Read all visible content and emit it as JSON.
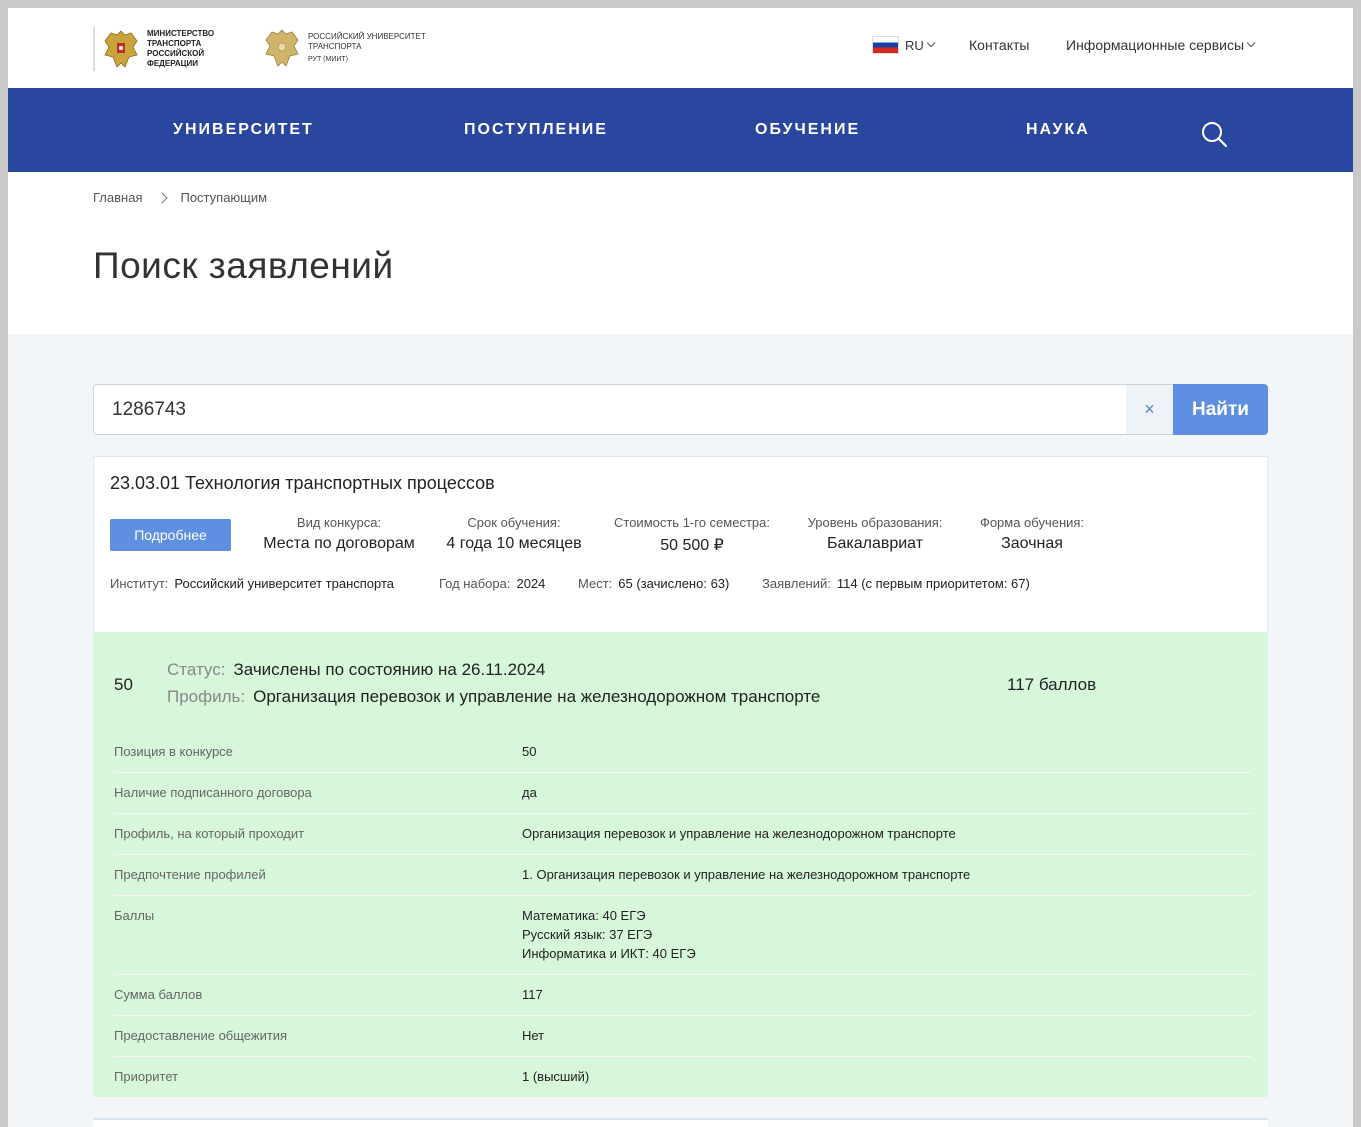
{
  "header": {
    "mintrans_logo_text": "МИНИСТЕРСТВО ТРАНСПОРТА РОССИЙСКОЙ ФЕДЕРАЦИИ",
    "rut_logo_text": "РОССИЙСКИЙ УНИВЕРСИТЕТ ТРАНСПОРТА",
    "rut_logo_abbr": "РУТ (МИИТ)",
    "lang": "RU",
    "contacts": "Контакты",
    "info_services": "Информационные сервисы"
  },
  "nav": {
    "items": [
      "УНИВЕРСИТЕТ",
      "ПОСТУПЛЕНИЕ",
      "ОБУЧЕНИЕ",
      "НАУКА"
    ]
  },
  "breadcrumb": [
    "Главная",
    "Поступающим"
  ],
  "page_title": "Поиск заявлений",
  "search": {
    "value": "1286743",
    "clear": "×",
    "button": "Найти"
  },
  "program": {
    "title": "23.03.01 Технология транспортных процессов",
    "more_button": "Подробнее",
    "meta": [
      {
        "label": "Вид конкурса:",
        "value": "Места по договорам"
      },
      {
        "label": "Срок обучения:",
        "value": "4 года 10 месяцев"
      },
      {
        "label": "Стоимость 1-го семестра:",
        "value": "50 500 ₽"
      },
      {
        "label": "Уровень образования:",
        "value": "Бакалавриат"
      },
      {
        "label": "Форма обучения:",
        "value": "Заочная"
      }
    ],
    "info": [
      {
        "label": "Институт:",
        "value": "Российский университет транспорта"
      },
      {
        "label": "Год набора:",
        "value": "2024"
      },
      {
        "label": "Мест:",
        "value": "65 (зачислено: 63)"
      },
      {
        "label": "Заявлений:",
        "value": "114 (с первым приоритетом: 67)"
      }
    ]
  },
  "result": {
    "number": "50",
    "status_label": "Статус:",
    "status_value": "Зачислены по состоянию на 26.11.2024",
    "profile_label": "Профиль:",
    "profile_value": "Организация перевозок и управление на железнодорожном транспорте",
    "score": "117 баллов",
    "details": [
      {
        "label": "Позиция в конкурсе",
        "value": "50"
      },
      {
        "label": "Наличие подписанного договора",
        "value": "да"
      },
      {
        "label": "Профиль, на который проходит",
        "value": "Организация перевозок и управление на железнодорожном транспорте"
      },
      {
        "label": "Предпочтение профилей",
        "value": "1. Организация перевозок и управление на железнодорожном транспорте"
      },
      {
        "label": "Баллы",
        "value": "Математика: 40 ЕГЭ\nРусский язык: 37 ЕГЭ\nИнформатика и ИКТ: 40 ЕГЭ"
      },
      {
        "label": "Сумма баллов",
        "value": "117"
      },
      {
        "label": "Предоставление общежития",
        "value": "Нет"
      },
      {
        "label": "Приоритет",
        "value": "1 (высший)"
      }
    ]
  }
}
